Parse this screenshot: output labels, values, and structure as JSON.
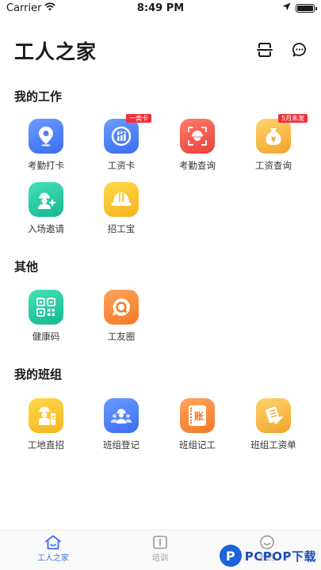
{
  "status_bar": {
    "carrier": "Carrier",
    "time": "8:49 PM"
  },
  "header": {
    "title": "工人之家"
  },
  "sections": {
    "work": {
      "title": "我的工作",
      "items": [
        {
          "label": "考勤打卡",
          "badge": ""
        },
        {
          "label": "工资卡",
          "badge": "一类卡"
        },
        {
          "label": "考勤查询",
          "badge": ""
        },
        {
          "label": "工资查询",
          "badge": "5月未发"
        },
        {
          "label": "入场邀请",
          "badge": ""
        },
        {
          "label": "招工宝",
          "badge": ""
        }
      ]
    },
    "other": {
      "title": "其他",
      "items": [
        {
          "label": "健康码"
        },
        {
          "label": "工友圈"
        }
      ]
    },
    "team": {
      "title": "我的班组",
      "items": [
        {
          "label": "工地直招"
        },
        {
          "label": "班组登记"
        },
        {
          "label": "班组记工",
          "icon_text": "账"
        },
        {
          "label": "班组工资单"
        }
      ]
    }
  },
  "tabbar": {
    "tabs": [
      {
        "label": "工人之家"
      },
      {
        "label": "培训"
      },
      {
        "label": "我的"
      }
    ]
  },
  "watermark": {
    "letter": "P",
    "text": "PCPOP下载"
  },
  "colors": {
    "accent": "#3a6df0",
    "blue_icon": "#4a7cf2",
    "red_icon": "#f05a4a",
    "gold_icon": "#f2b63a",
    "green_icon": "#20c5a0",
    "orange_icon": "#f7893a",
    "badge_red": "#f0303a"
  },
  "icons": [
    "wifi-icon",
    "location-arrow-icon",
    "battery-icon",
    "scan-icon",
    "message-icon",
    "location-pin-icon",
    "bank-card-icon",
    "face-scan-icon",
    "money-bag-icon",
    "invite-user-icon",
    "hardhat-icon",
    "qr-code-icon",
    "chat-bubble-icon",
    "worker-icon",
    "team-icon",
    "ledger-icon",
    "payslip-icon",
    "home-icon",
    "book-icon",
    "profile-icon"
  ]
}
